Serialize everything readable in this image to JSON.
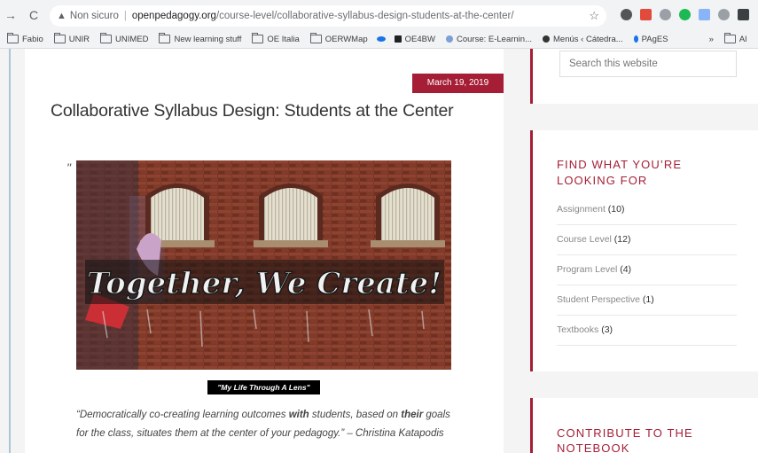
{
  "browser": {
    "insecure_label": "Non sicuro",
    "url_domain": "openpedagogy.org",
    "url_path": "/course-level/collaborative-syllabus-design-students-at-the-center/",
    "bookmarks": [
      "Fabio",
      "UNIR",
      "UNIMED",
      "New learning stuff",
      "OE Italia",
      "OERWMap",
      "OE4BW",
      "Course: E-Learnin...",
      "Menús ‹ Cátedra...",
      "PAgES"
    ],
    "bookmarks_more": "»",
    "bookmarks_last": "Al"
  },
  "article": {
    "date": "March 19, 2019",
    "title": "Collaborative Syllabus Design: Students at the Center",
    "image_caption": "\"My Life Through A Lens\"",
    "mural_text": "Together, We Create!",
    "quote_line1_a": "“Democratically co-creating learning outcomes ",
    "quote_line1_b": "with",
    "quote_line1_c": " students, based on ",
    "quote_line1_d": "their",
    "quote_line1_e": " goals",
    "quote_line2": "for the class, situates them at the center of your pedagogy.” – Christina Katapodis"
  },
  "sidebar": {
    "search_placeholder": "Search this website",
    "find_title_1": "FIND WHAT YOU’RE",
    "find_title_2": "LOOKING FOR",
    "categories": [
      {
        "name": "Assignment",
        "count": "(10)"
      },
      {
        "name": "Course Level",
        "count": "(12)"
      },
      {
        "name": "Program Level",
        "count": "(4)"
      },
      {
        "name": "Student Perspective",
        "count": "(1)"
      },
      {
        "name": "Textbooks",
        "count": "(3)"
      }
    ],
    "contribute_title_1": "CONTRIBUTE TO THE",
    "contribute_title_2": "NOTEBOOK"
  },
  "colors": {
    "accent": "#a51e36",
    "text": "#333333"
  }
}
